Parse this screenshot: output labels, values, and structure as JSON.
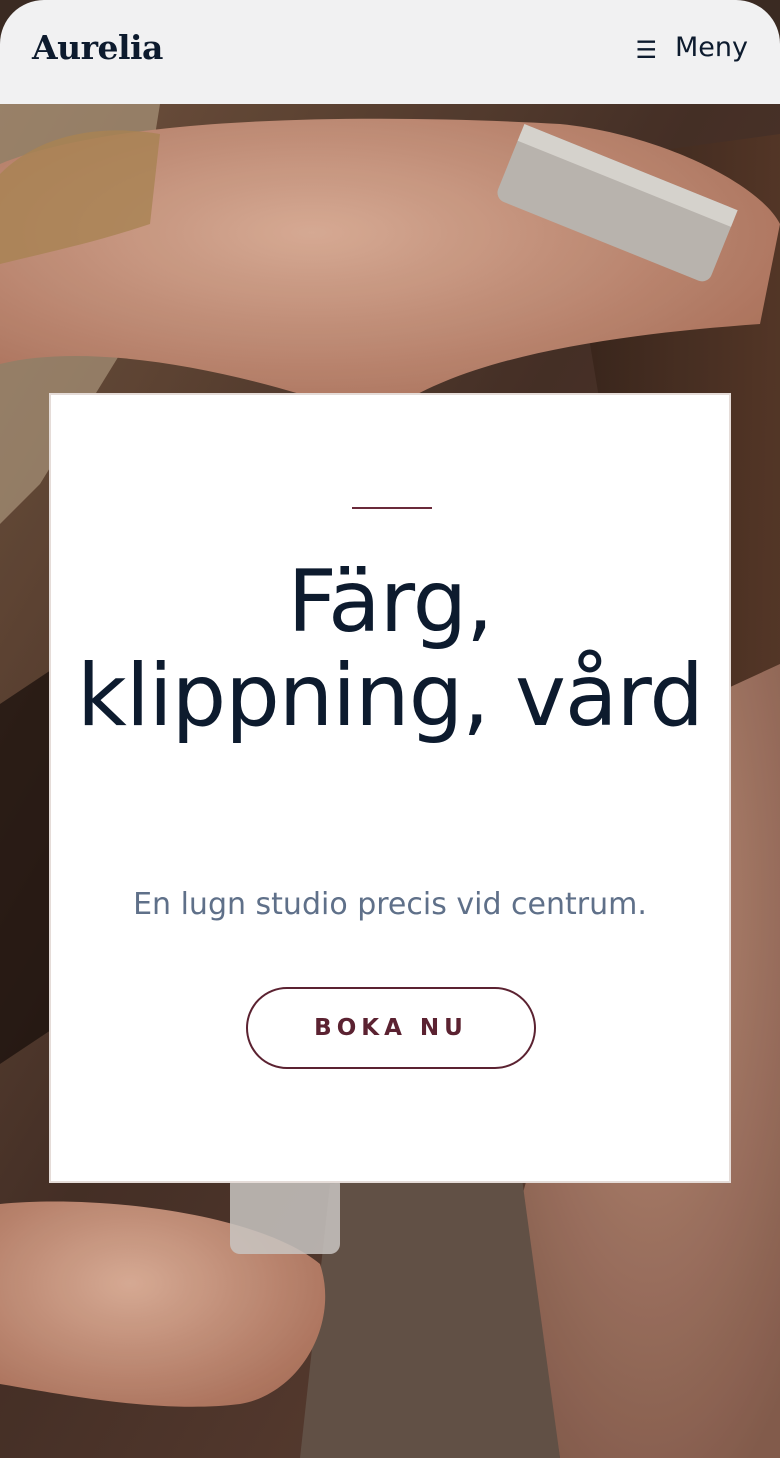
{
  "brand": {
    "logo": "Aurelia"
  },
  "nav": {
    "menu_label": "Meny",
    "menu_icon": "hamburger-icon"
  },
  "hero": {
    "title": "Färg, klippning, vård",
    "subtitle": "En lugn studio precis vid centrum.",
    "cta_label": "BOKA NU"
  },
  "colors": {
    "header_bg": "#f1f1f2",
    "text_dark": "#0d1b2e",
    "accent": "#5b2231",
    "subtitle": "#5f7089",
    "card_bg": "#ffffff"
  }
}
